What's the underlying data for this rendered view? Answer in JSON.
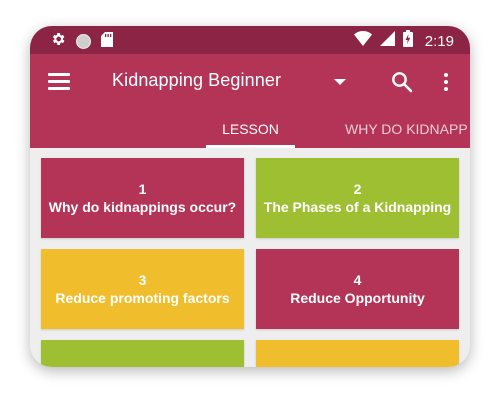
{
  "status_bar": {
    "time": "2:19",
    "icons": [
      "gear-icon",
      "circle-icon",
      "sd-card-icon",
      "wifi-icon",
      "signal-icon",
      "battery-charging-icon"
    ]
  },
  "toolbar": {
    "title": "Kidnapping Beginner",
    "icons": [
      "menu-icon",
      "dropdown-icon",
      "search-icon",
      "more-vert-icon"
    ]
  },
  "tabs": [
    {
      "label": "LESSON",
      "active": true
    },
    {
      "label": "WHY DO KIDNAPP",
      "active": false
    }
  ],
  "lessons": [
    {
      "number": "1",
      "title": "Why do kidnappings occur?",
      "color": "#b43457"
    },
    {
      "number": "2",
      "title": "The Phases of a Kidnapping",
      "color": "#9ebf32"
    },
    {
      "number": "3",
      "title": "Reduce promoting factors",
      "color": "#f0bd2c"
    },
    {
      "number": "4",
      "title": "Reduce Opportunity",
      "color": "#b43457"
    },
    {
      "number": "",
      "title": "",
      "color": "#9ebf32"
    },
    {
      "number": "",
      "title": "",
      "color": "#f0bd2c"
    }
  ],
  "colors": {
    "status_bar": "#8c2446",
    "toolbar": "#b43457",
    "grid_background": "#eeeeee"
  }
}
